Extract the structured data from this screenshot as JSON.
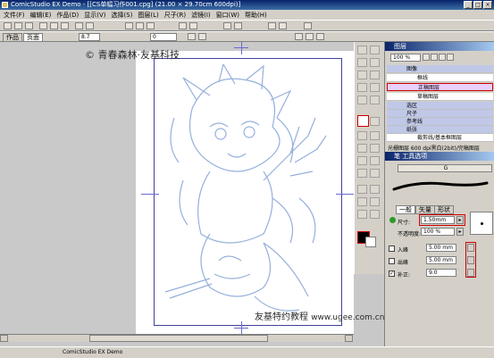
{
  "window": {
    "title": "ComicStudio EX Demo - [[CS单幅习作001.cpg] (21.00 × 29.70cm 600dpi)]"
  },
  "menu": [
    "文件(F)",
    "编辑(E)",
    "作品(D)",
    "显示(V)",
    "选择(S)",
    "图层(L)",
    "尺子(R)",
    "滤镜(I)",
    "窗口(W)",
    "帮助(H)"
  ],
  "toolbar": {
    "tab_work": "作品",
    "tab_page": "页面",
    "brush_size": "8.7",
    "rotation": "0"
  },
  "canvas": {
    "watermark_top": "© 青春森林·友基科技",
    "watermark_bottom": "友基特约教程",
    "watermark_url": "www.ugee.com.cn"
  },
  "layers_panel": {
    "title": "图层",
    "zoom": "100 %",
    "items": [
      {
        "label": "图像"
      },
      {
        "label": "框线"
      },
      {
        "label": "正稿图层"
      },
      {
        "label": "草稿图层"
      },
      {
        "label": "选区"
      },
      {
        "label": "尺子"
      },
      {
        "label": "参考线"
      },
      {
        "label": "纸张"
      },
      {
        "label": "裁剪线/基本框图层"
      }
    ],
    "info": "光栅图层 600 dpi黑白(2bit)/完稿图层"
  },
  "tool_options": {
    "title": "笔 工具选项",
    "preset": "G",
    "tabs": [
      "一般",
      "矢量",
      "形状"
    ],
    "size_label": "尺寸:",
    "size_value": "1.50mm",
    "opacity_label": "不透明度:",
    "opacity_value": "100 %",
    "in_label": "入峰",
    "in_value": "5.00 mm",
    "out_label": "出峰",
    "out_value": "5.00 mm",
    "correction_label": "补正:",
    "correction_value": "9.0"
  },
  "statusbar": {
    "text": "ComicStudio EX Demo"
  }
}
